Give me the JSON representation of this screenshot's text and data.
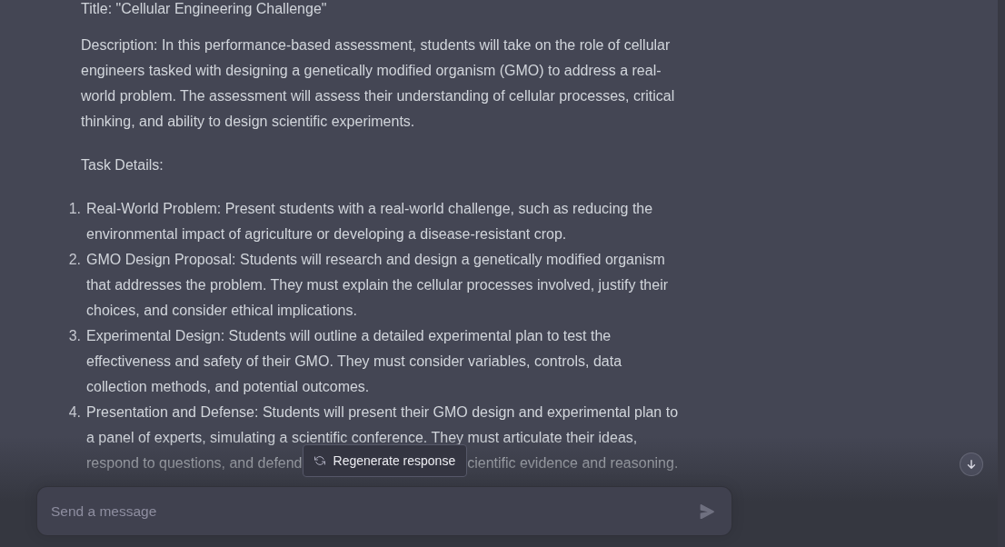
{
  "message": {
    "title": "Title: \"Cellular Engineering Challenge\"",
    "description": "Description: In this performance-based assessment, students will take on the role of cellular engineers tasked with designing a genetically modified organism (GMO) to address a real-world problem. The assessment will assess their understanding of cellular processes, critical thinking, and ability to design scientific experiments.",
    "section_heading": "Task Details:",
    "tasks": [
      {
        "number": "1.",
        "text": "Real-World Problem: Present students with a real-world challenge, such as reducing the environmental impact of agriculture or developing a disease-resistant crop."
      },
      {
        "number": "2.",
        "text": "GMO Design Proposal: Students will research and design a genetically modified organism that addresses the problem. They must explain the cellular processes involved, justify their choices, and consider ethical implications."
      },
      {
        "number": "3.",
        "text": "Experimental Design: Students will outline a detailed experimental plan to test the effectiveness and safety of their GMO. They must consider variables, controls, data collection methods, and potential outcomes."
      },
      {
        "number": "4.",
        "text": "Presentation and Defense: Students will present their GMO design and experimental plan to a panel of experts, simulating a scientific conference. They must articulate their ideas,",
        "fragments_beside_cover": [
          "respond to questions, and defend",
          "cientific evidence and reasoning."
        ]
      }
    ]
  },
  "regenerate_button": {
    "label": "Regenerate response"
  },
  "composer": {
    "placeholder": "Send a message"
  }
}
